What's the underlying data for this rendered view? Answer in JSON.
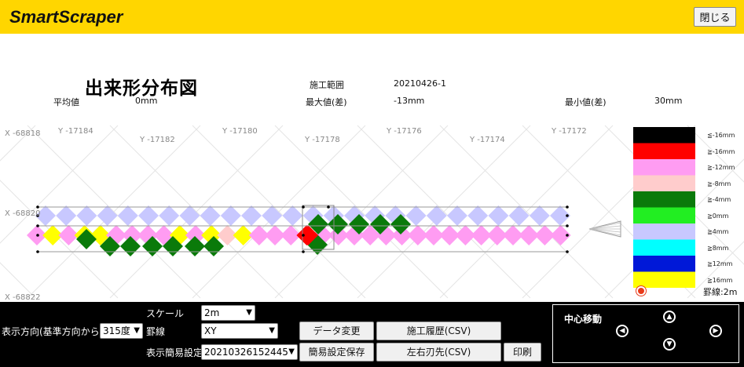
{
  "app": {
    "brand": "SmartScraper",
    "close_label": "閉じる"
  },
  "summary": {
    "title": "出来形分布図",
    "range_label": "施工範囲",
    "range_value": "20210426-1",
    "avg_label": "平均値",
    "avg_value": "0mm",
    "max_label": "最大値(差)",
    "max_value": "-13mm",
    "min_label": "最小値(差)",
    "min_value": "30mm"
  },
  "grid": {
    "x_labels": [
      "X -68818",
      "X -68820",
      "X -68822"
    ],
    "y_labels": [
      "Y -17184",
      "Y -17182",
      "Y -17180",
      "Y -17178",
      "Y -17176",
      "Y -17174",
      "Y -17172"
    ]
  },
  "legend": {
    "items": [
      {
        "label": "≦-16mm",
        "color": "#000000"
      },
      {
        "label": "≧-16mm",
        "color": "#ff0000"
      },
      {
        "label": "≧-12mm",
        "color": "#ff9cf2"
      },
      {
        "label": "≧-8mm",
        "color": "#ffcccc"
      },
      {
        "label": "≧-4mm",
        "color": "#0a7a0a"
      },
      {
        "label": "≧0mm",
        "color": "#22ee22"
      },
      {
        "label": "≧4mm",
        "color": "#c8c8ff"
      },
      {
        "label": "≧8mm",
        "color": "#00ffff"
      },
      {
        "label": "≧12mm",
        "color": "#0018d8"
      },
      {
        "label": "≧16mm",
        "color": "#ffff00"
      }
    ],
    "grid_note": "罫線:2m"
  },
  "controls": {
    "scale_label": "スケール",
    "scale_value": "2m",
    "direction_label": "表示方向(基準方向から)",
    "direction_value": "315度",
    "grid_label": "罫線",
    "grid_value": "XY",
    "preset_label": "表示簡易設定",
    "preset_value": "20210326152445",
    "data_change": "データ変更",
    "history_csv": "施工履歴(CSV)",
    "save_preset": "簡易設定保存",
    "blade_csv": "左右刃先(CSV)",
    "print": "印刷",
    "center_move": "中心移動"
  },
  "colors": {
    "accent": "#ffd600",
    "panel": "#000000"
  }
}
